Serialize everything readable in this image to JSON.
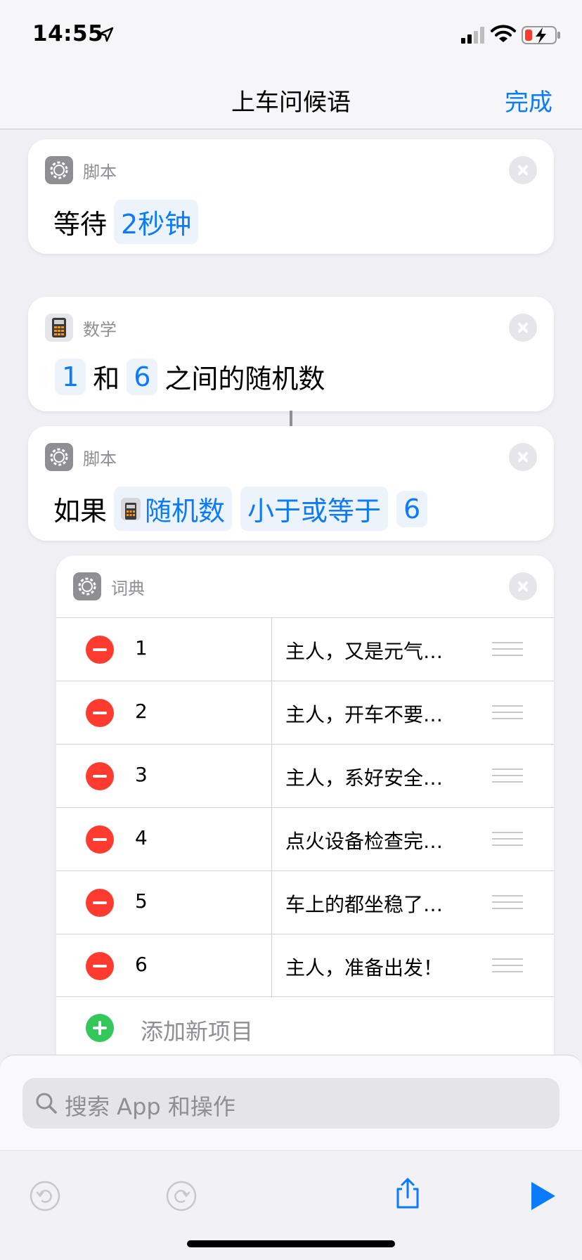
{
  "status": {
    "time": "14:55"
  },
  "nav": {
    "title": "上车问候语",
    "done": "完成"
  },
  "cards": {
    "wait": {
      "category": "脚本",
      "verb": "等待",
      "token": "2秒钟"
    },
    "random": {
      "category": "数学",
      "min": "1",
      "and": "和",
      "max": "6",
      "suffix": "之间的随机数"
    },
    "if": {
      "category": "脚本",
      "verb": "如果",
      "var": "随机数",
      "op": "小于或等于",
      "value": "6"
    },
    "dict": {
      "category": "词典",
      "rows": [
        {
          "key": "1",
          "value": "主人，又是元气…"
        },
        {
          "key": "2",
          "value": "主人，开车不要…"
        },
        {
          "key": "3",
          "value": "主人，系好安全…"
        },
        {
          "key": "4",
          "value": "点火设备检查完…"
        },
        {
          "key": "5",
          "value": "车上的都坐稳了…"
        },
        {
          "key": "6",
          "value": "主人，准备出发！"
        }
      ],
      "add_label": "添加新项目"
    }
  },
  "search": {
    "placeholder": "搜索 App 和操作"
  },
  "colors": {
    "accent": "#0a7aff",
    "minus": "#ff3b30",
    "plus": "#34c759"
  }
}
